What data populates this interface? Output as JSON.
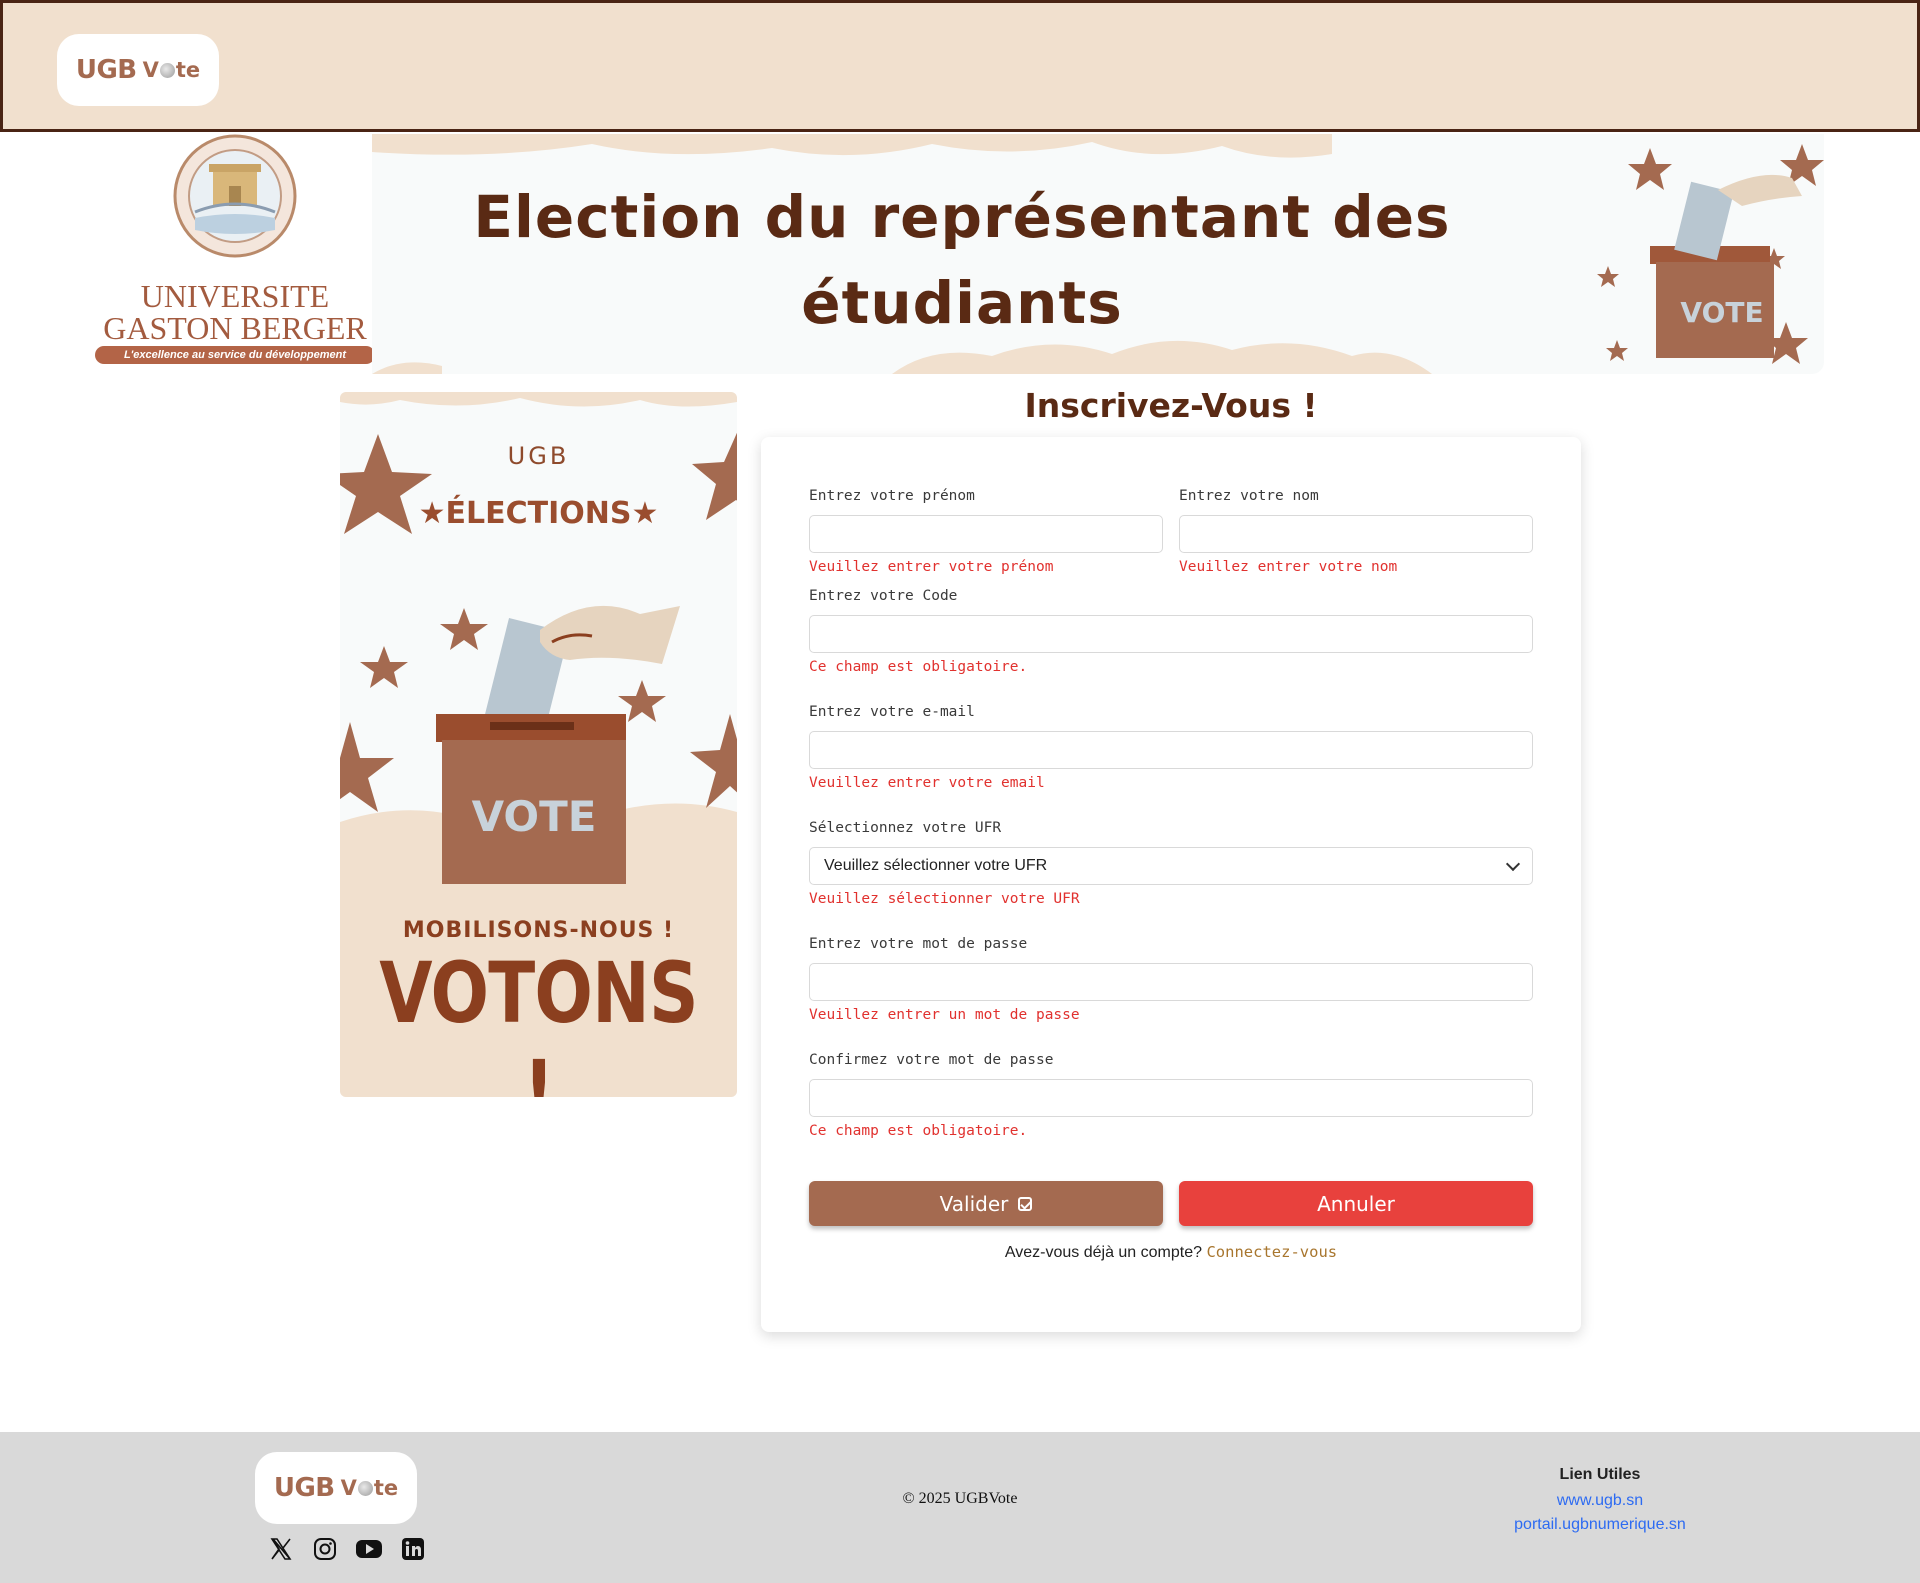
{
  "navbar": {
    "logo_ugb": "UGB",
    "logo_vote": "Vte"
  },
  "banner": {
    "title_line1": "Election du représentant des",
    "title_line2": "étudiants",
    "university_line1": "UNIVERSITE",
    "university_line2": "GASTON BERGER",
    "university_motto": "L'excellence au service du développement",
    "vote_box_label": "VOTE"
  },
  "poster": {
    "ugb": "UGB",
    "elections": "★ÉLECTIONS★",
    "box_label": "VOTE",
    "mobilisons": "MOBILISONS-NOUS !",
    "votons": "VOTONS !"
  },
  "form": {
    "title": "Inscrivez-Vous !",
    "prenom": {
      "label": "Entrez votre prénom",
      "value": "",
      "error": "Veuillez entrer votre prénom"
    },
    "nom": {
      "label": "Entrez votre nom",
      "value": "",
      "error": "Veuillez entrer votre nom"
    },
    "code": {
      "label": "Entrez votre Code",
      "value": "",
      "error": "Ce champ est obligatoire."
    },
    "email": {
      "label": "Entrez votre e-mail",
      "value": "",
      "error": "Veuillez entrer votre email"
    },
    "ufr": {
      "label": "Sélectionnez votre UFR",
      "selected": "Veuillez sélectionner votre UFR",
      "error": "Veuillez sélectionner votre UFR"
    },
    "password": {
      "label": "Entrez votre mot de passe",
      "value": "",
      "error": "Veuillez entrer un mot de passe"
    },
    "confirm": {
      "label": "Confirmez votre mot de passe",
      "value": "",
      "error": "Ce champ est obligatoire."
    },
    "submit_label": "Valider",
    "cancel_label": "Annuler",
    "login_prompt": "Avez-vous déjà un compte?",
    "login_link": "Connectez-vous"
  },
  "footer": {
    "logo_ugb": "UGB",
    "logo_vote": "Vte",
    "copyright": "© 2025 UGBVote",
    "links_title": "Lien Utiles",
    "links": [
      "www.ugb.sn",
      "portail.ugbnumerique.sn"
    ],
    "socials": [
      "x-icon",
      "instagram-icon",
      "youtube-icon",
      "linkedin-icon"
    ]
  },
  "colors": {
    "brand": "#a46a50",
    "dark_brown": "#5a2a14",
    "nav_bg": "#f1e0ce",
    "error": "#e1312e",
    "cancel": "#e8413d",
    "link": "#2d6bf2"
  }
}
